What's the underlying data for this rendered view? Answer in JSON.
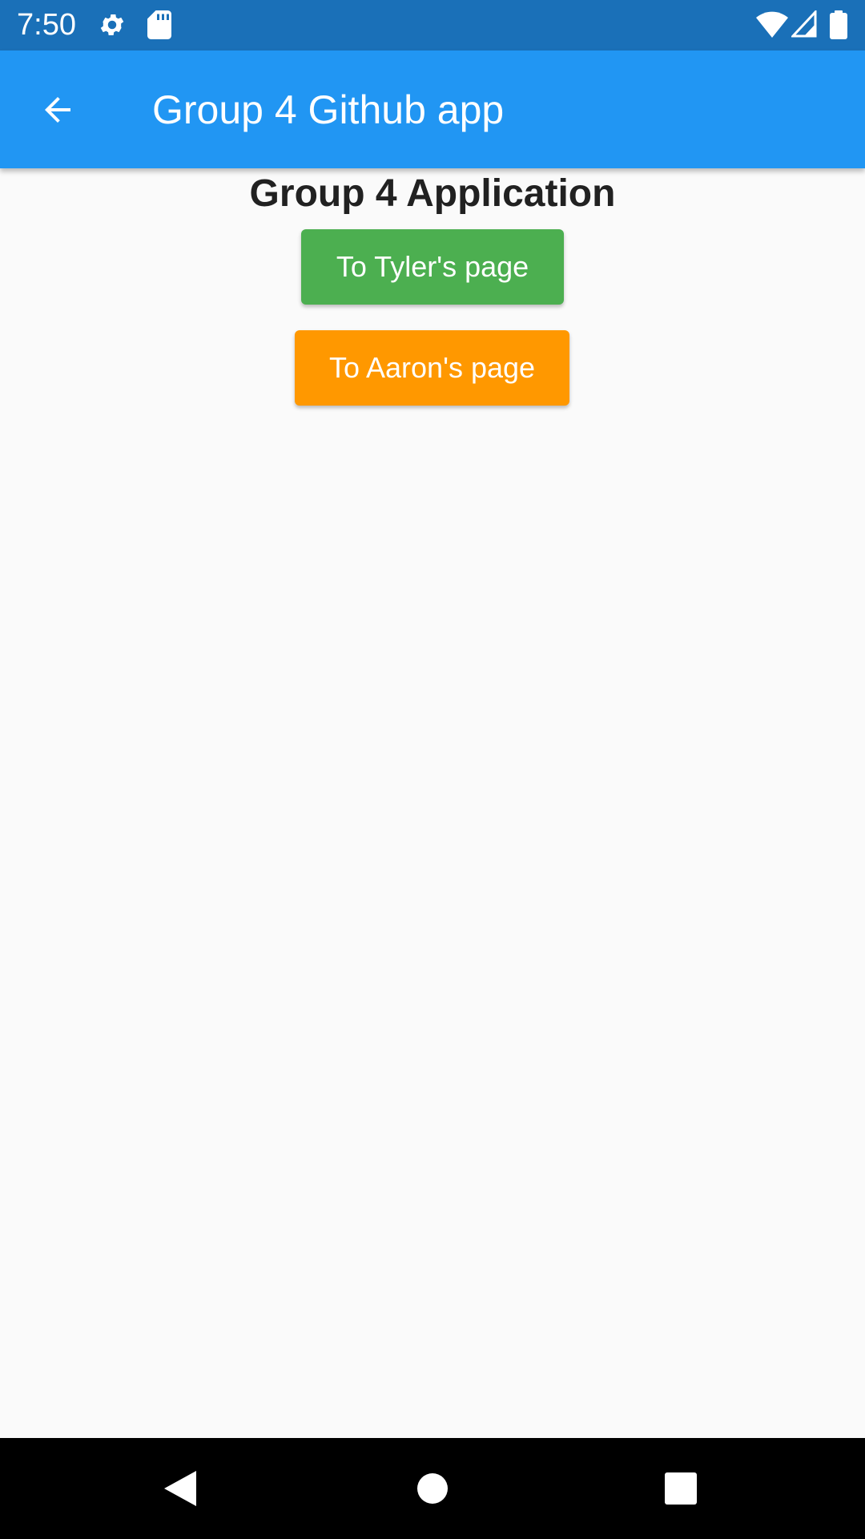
{
  "status_bar": {
    "time": "7:50",
    "icons": [
      "gear-icon",
      "sd-card-icon",
      "wifi-icon",
      "signal-icon",
      "battery-icon"
    ],
    "background": "#1a70b8"
  },
  "app_bar": {
    "title": "Group 4 Github app",
    "back_icon": "arrow-back-icon",
    "background": "#2196f3"
  },
  "main": {
    "heading": "Group 4 Application",
    "buttons": [
      {
        "label": "To Tyler's page",
        "color": "#4caf50"
      },
      {
        "label": "To Aaron's page",
        "color": "#ff9800"
      }
    ]
  },
  "nav_bar": {
    "icons": [
      "back-triangle-icon",
      "home-circle-icon",
      "recents-square-icon"
    ]
  }
}
